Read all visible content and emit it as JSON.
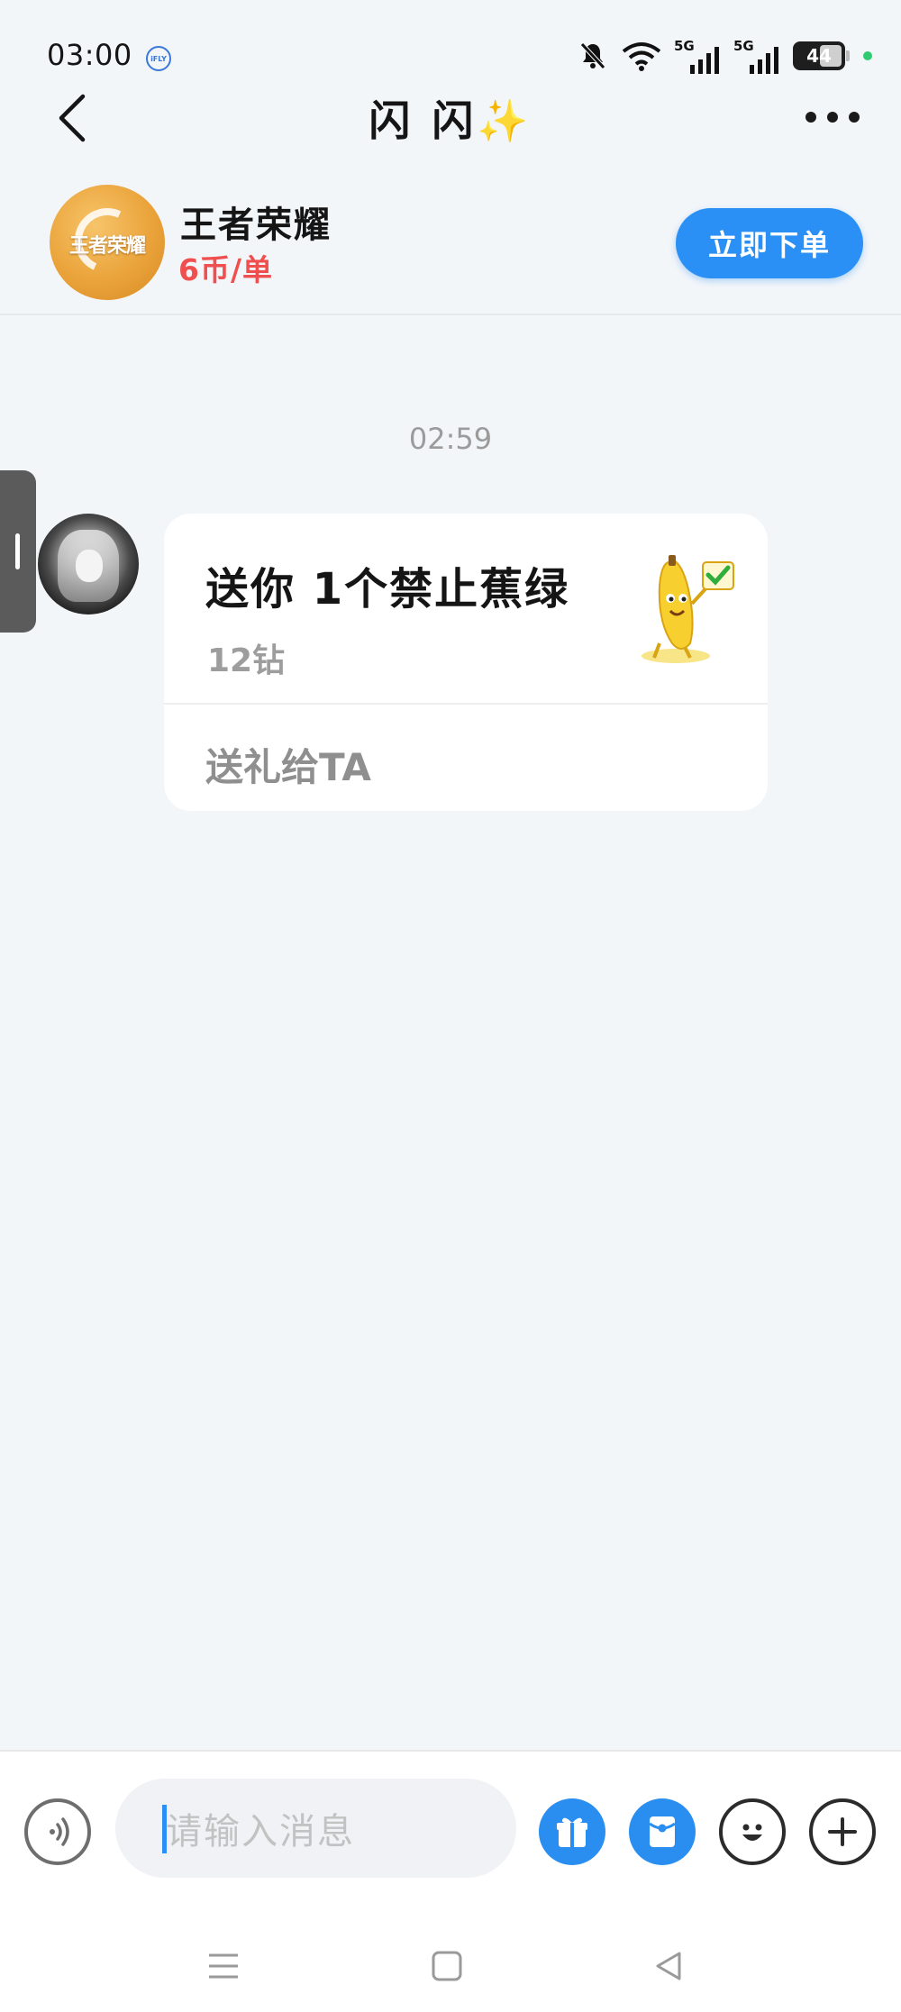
{
  "status_bar": {
    "time": "03:00",
    "iflytek_label": "iFLY",
    "network_1": "5G",
    "network_2": "5G",
    "battery": "44"
  },
  "header": {
    "title": "闪 闪",
    "title_emoji": "✨"
  },
  "service": {
    "game_name": "王者荣耀",
    "logo_text": "王者荣耀",
    "price": "6币/单",
    "order_button": "立即下单"
  },
  "messages": {
    "timestamp": "02:59",
    "gift": {
      "title": "送你  1个禁止蕉绿",
      "price": "12钻",
      "action": "送礼给TA"
    }
  },
  "input": {
    "placeholder": "请输入消息"
  },
  "colors": {
    "accent_blue": "#2a90f5",
    "price_red": "#f04f4f",
    "background": "#f3f6f9"
  }
}
